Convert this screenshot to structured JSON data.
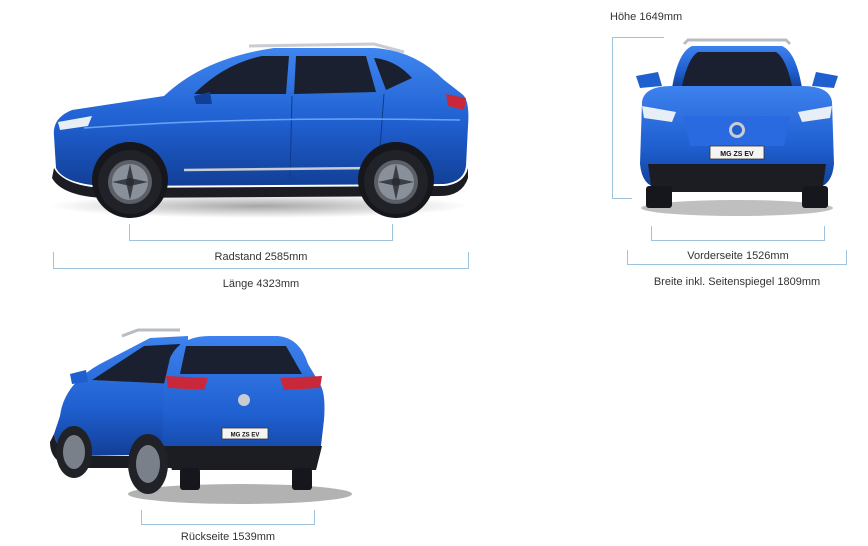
{
  "side_view": {
    "wheelbase_label": "Radstand 2585mm",
    "length_label": "Länge 4323mm",
    "plate_text": ""
  },
  "front_view": {
    "height_label": "Höhe 1649mm",
    "front_track_label": "Vorderseite 1526mm",
    "width_label": "Breite inkl. Seitenspiegel 1809mm",
    "plate_text": "MG ZS EV"
  },
  "rear_view": {
    "rear_track_label": "Rückseite 1539mm",
    "plate_text": "MG ZS EV"
  },
  "colors": {
    "car_body": "#1f5fd0",
    "dimension_lines": "#9fc3dc",
    "text": "#333333"
  }
}
